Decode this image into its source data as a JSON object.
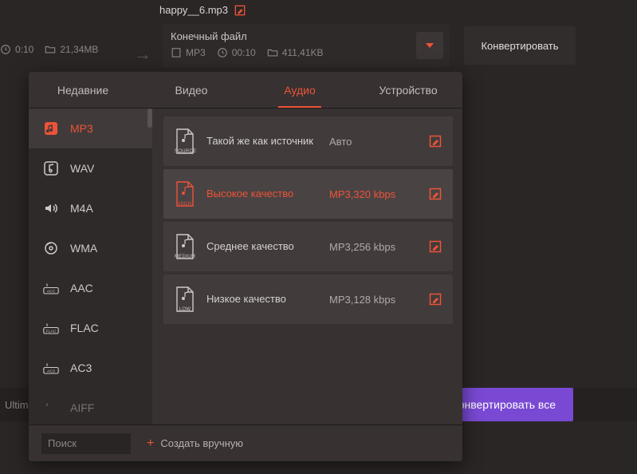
{
  "source": {
    "filename": "happy__6.mp3",
    "duration": "0:10",
    "size": "21,34MB"
  },
  "dest": {
    "title": "Конечный файл",
    "format": "MP3",
    "duration": "00:10",
    "size": "411,41KB"
  },
  "convert_btn": "Конвертировать",
  "tabs": {
    "recent": "Недавние",
    "video": "Видео",
    "audio": "Аудио",
    "device": "Устройство"
  },
  "formats": {
    "mp3": "MP3",
    "wav": "WAV",
    "m4a": "M4A",
    "wma": "WMA",
    "aac": "AAC",
    "flac": "FLAC",
    "ac3": "AC3",
    "aiff": "AIFF"
  },
  "presets": {
    "source": {
      "title": "Такой же как источник",
      "spec": "Авто",
      "tag": "SOURCE"
    },
    "high": {
      "title": "Высокое качество",
      "spec": "MP3,320 kbps",
      "tag": "HIGH"
    },
    "medium": {
      "title": "Среднее качество",
      "spec": "MP3,256 kbps",
      "tag": "MEDIUM"
    },
    "low": {
      "title": "Низкое качество",
      "spec": "MP3,128 kbps",
      "tag": "LOW"
    }
  },
  "search": {
    "placeholder": "Поиск"
  },
  "create_manual": "Создать вручную",
  "bottom_status": "Ultima",
  "convert_all": "Конвертировать все"
}
